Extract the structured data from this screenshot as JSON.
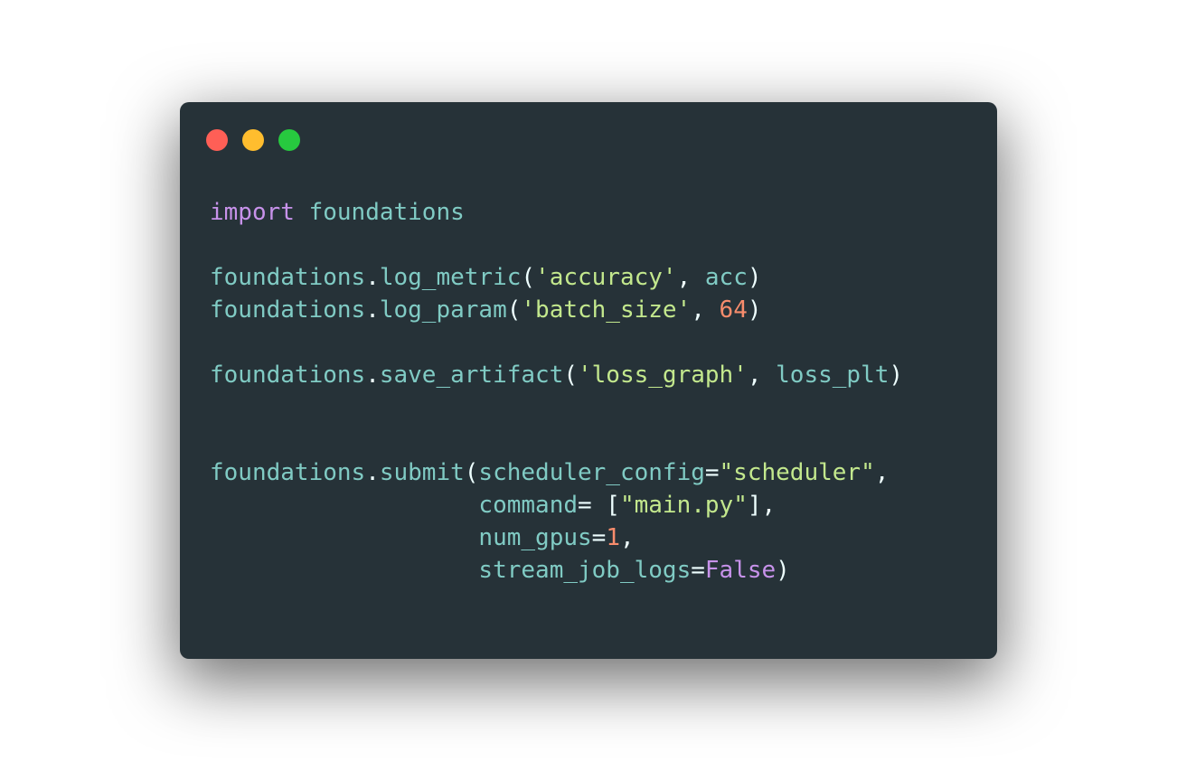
{
  "window": {
    "controls": [
      "close",
      "minimize",
      "maximize"
    ],
    "colors": {
      "background": "#263238",
      "close": "#ff5f56",
      "minimize": "#ffbd2e",
      "maximize": "#27c93f"
    }
  },
  "code": {
    "language": "python",
    "syntax_colors": {
      "keyword": "#c792ea",
      "identifier": "#80cbc4",
      "punctuation": "#eeffff",
      "string": "#c3e88d",
      "number": "#f78c6c"
    },
    "lines": [
      [
        {
          "t": "import",
          "c": "kw"
        },
        {
          "t": " ",
          "c": "punc"
        },
        {
          "t": "foundations",
          "c": "id"
        }
      ],
      [],
      [
        {
          "t": "foundations",
          "c": "id"
        },
        {
          "t": ".",
          "c": "punc"
        },
        {
          "t": "log_metric",
          "c": "id"
        },
        {
          "t": "(",
          "c": "punc"
        },
        {
          "t": "'accuracy'",
          "c": "str"
        },
        {
          "t": ", ",
          "c": "punc"
        },
        {
          "t": "acc",
          "c": "id"
        },
        {
          "t": ")",
          "c": "punc"
        }
      ],
      [
        {
          "t": "foundations",
          "c": "id"
        },
        {
          "t": ".",
          "c": "punc"
        },
        {
          "t": "log_param",
          "c": "id"
        },
        {
          "t": "(",
          "c": "punc"
        },
        {
          "t": "'batch_size'",
          "c": "str"
        },
        {
          "t": ", ",
          "c": "punc"
        },
        {
          "t": "64",
          "c": "num"
        },
        {
          "t": ")",
          "c": "punc"
        }
      ],
      [],
      [
        {
          "t": "foundations",
          "c": "id"
        },
        {
          "t": ".",
          "c": "punc"
        },
        {
          "t": "save_artifact",
          "c": "id"
        },
        {
          "t": "(",
          "c": "punc"
        },
        {
          "t": "'loss_graph'",
          "c": "str"
        },
        {
          "t": ", ",
          "c": "punc"
        },
        {
          "t": "loss_plt",
          "c": "id"
        },
        {
          "t": ")",
          "c": "punc"
        }
      ],
      [],
      [],
      [
        {
          "t": "foundations",
          "c": "id"
        },
        {
          "t": ".",
          "c": "punc"
        },
        {
          "t": "submit",
          "c": "id"
        },
        {
          "t": "(",
          "c": "punc"
        },
        {
          "t": "scheduler_config",
          "c": "id"
        },
        {
          "t": "=",
          "c": "punc"
        },
        {
          "t": "\"scheduler\"",
          "c": "str"
        },
        {
          "t": ",",
          "c": "punc"
        }
      ],
      [
        {
          "t": "                   ",
          "c": "punc"
        },
        {
          "t": "command",
          "c": "id"
        },
        {
          "t": "= [",
          "c": "punc"
        },
        {
          "t": "\"main.py\"",
          "c": "str"
        },
        {
          "t": "],",
          "c": "punc"
        }
      ],
      [
        {
          "t": "                   ",
          "c": "punc"
        },
        {
          "t": "num_gpus",
          "c": "id"
        },
        {
          "t": "=",
          "c": "punc"
        },
        {
          "t": "1",
          "c": "num"
        },
        {
          "t": ",",
          "c": "punc"
        }
      ],
      [
        {
          "t": "                   ",
          "c": "punc"
        },
        {
          "t": "stream_job_logs",
          "c": "id"
        },
        {
          "t": "=",
          "c": "punc"
        },
        {
          "t": "False",
          "c": "kw"
        },
        {
          "t": ")",
          "c": "punc"
        }
      ]
    ]
  }
}
